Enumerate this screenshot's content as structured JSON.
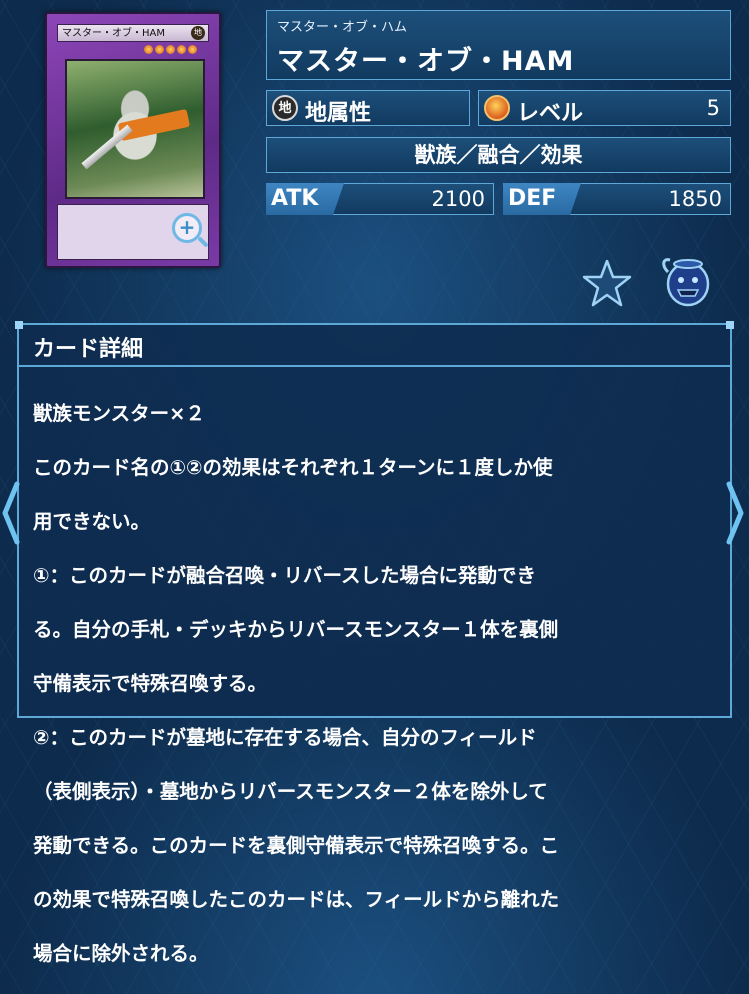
{
  "card": {
    "name_small": "マスター・オブ・HAM",
    "attribute_glyph": "地",
    "star_count": 5,
    "zoom_icon": "zoom-in-icon"
  },
  "info": {
    "name_ruby": "マスター・オブ・ハム",
    "name": "マスター・オブ・HAM",
    "attribute_icon_glyph": "地",
    "attribute_label": "地属性",
    "level_label": "レベル",
    "level_value": "5",
    "type_line": "獣族／融合／効果",
    "atk_label": "ATK",
    "atk_value": "2100",
    "def_label": "DEF",
    "def_value": "1850"
  },
  "actions": {
    "favorite_icon": "star-icon",
    "collection_icon": "pot-icon"
  },
  "detail": {
    "title": "カード詳細",
    "lines": [
      "獣族モンスター×２",
      "このカード名の①②の効果はそれぞれ１ターンに１度しか使",
      "用できない。",
      "①：このカードが融合召喚・リバースした場合に発動でき",
      "る。自分の手札・デッキからリバースモンスター１体を裏側",
      "守備表示で特殊召喚する。",
      "②：このカードが墓地に存在する場合、自分のフィールド",
      "（表側表示）・墓地からリバースモンスター２体を除外して",
      "発動できる。このカードを裏側守備表示で特殊召喚する。こ",
      "の効果で特殊召喚したこのカードは、フィールドから離れた",
      "場合に除外される。"
    ]
  },
  "nav": {
    "prev": "〈",
    "next": "〉"
  },
  "colors": {
    "accent": "#5ea8d8",
    "panel": "#1c4f7a",
    "card_frame": "#8d46b8"
  }
}
